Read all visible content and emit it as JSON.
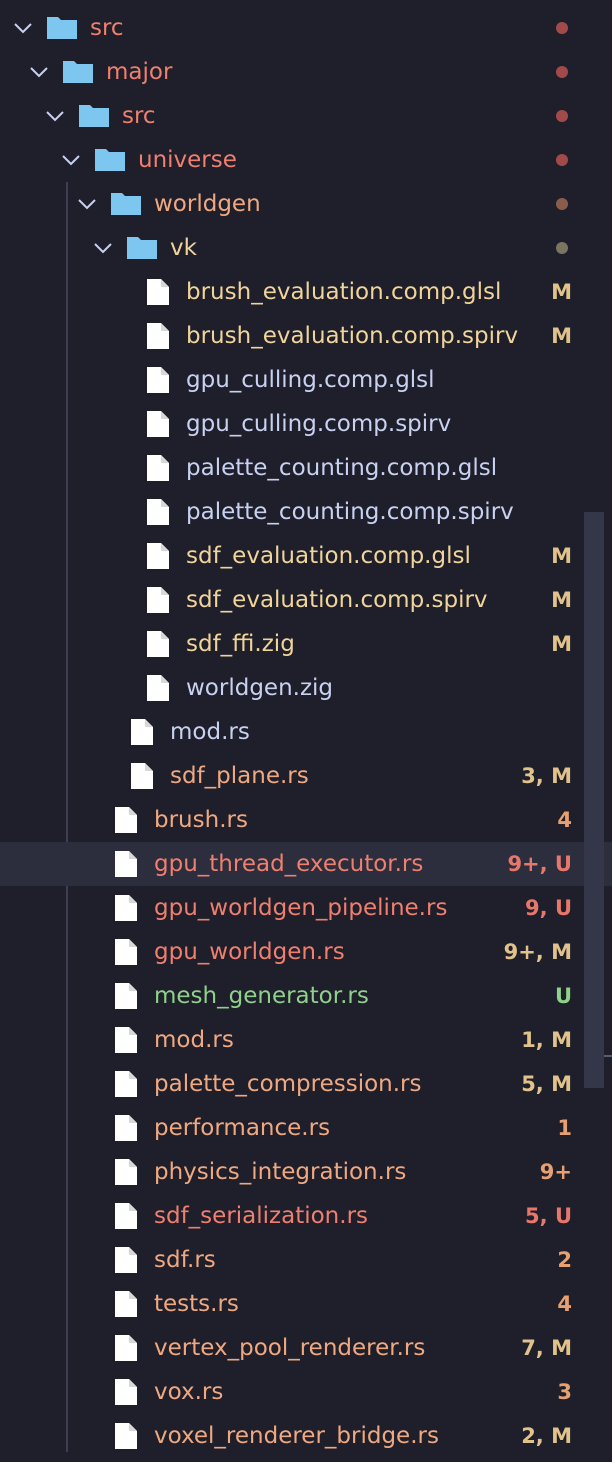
{
  "colors": {
    "background": "#1e1f2b",
    "folder_label": "#f07f6e",
    "file_default": "#c9d1f0",
    "file_modified": "#f0d49a",
    "file_untracked": "#f07f6e",
    "file_added": "#8fd18a",
    "file_warning": "#f0a880",
    "badge_m": "#e0c28a",
    "badge_u_red": "#e8776b",
    "badge_u_green": "#8fd18a",
    "badge_warn": "#e8a070",
    "folder_icon": "#7cc6f0",
    "chevron": "#c9d1f0"
  },
  "explorer": {
    "folders": [
      {
        "name": "src"
      },
      {
        "name": "major"
      },
      {
        "name": "src"
      },
      {
        "name": "universe"
      },
      {
        "name": "worldgen"
      },
      {
        "name": "vk"
      }
    ],
    "vk_files": [
      {
        "name": "brush_evaluation.comp.glsl",
        "badge": "M"
      },
      {
        "name": "brush_evaluation.comp.spirv",
        "badge": "M"
      },
      {
        "name": "gpu_culling.comp.glsl",
        "badge": ""
      },
      {
        "name": "gpu_culling.comp.spirv",
        "badge": ""
      },
      {
        "name": "palette_counting.comp.glsl",
        "badge": ""
      },
      {
        "name": "palette_counting.comp.spirv",
        "badge": ""
      },
      {
        "name": "sdf_evaluation.comp.glsl",
        "badge": "M"
      },
      {
        "name": "sdf_evaluation.comp.spirv",
        "badge": "M"
      },
      {
        "name": "sdf_ffi.zig",
        "badge": "M"
      },
      {
        "name": "worldgen.zig",
        "badge": ""
      }
    ],
    "worldgen_files": [
      {
        "name": "mod.rs",
        "badge": ""
      },
      {
        "name": "sdf_plane.rs",
        "badge": "3, M"
      }
    ],
    "universe_files": [
      {
        "name": "brush.rs",
        "badge": "4"
      },
      {
        "name": "gpu_thread_executor.rs",
        "badge": "9+, U"
      },
      {
        "name": "gpu_worldgen_pipeline.rs",
        "badge": "9, U"
      },
      {
        "name": "gpu_worldgen.rs",
        "badge": "9+, M"
      },
      {
        "name": "mesh_generator.rs",
        "badge": "U"
      },
      {
        "name": "mod.rs",
        "badge": "1, M"
      },
      {
        "name": "palette_compression.rs",
        "badge": "5, M"
      },
      {
        "name": "performance.rs",
        "badge": "1"
      },
      {
        "name": "physics_integration.rs",
        "badge": "9+"
      },
      {
        "name": "sdf_serialization.rs",
        "badge": "5, U"
      },
      {
        "name": "sdf.rs",
        "badge": "2"
      },
      {
        "name": "tests.rs",
        "badge": "4"
      },
      {
        "name": "vertex_pool_renderer.rs",
        "badge": "7, M"
      },
      {
        "name": "vox.rs",
        "badge": "3"
      },
      {
        "name": "voxel_renderer_bridge.rs",
        "badge": "2, M"
      }
    ]
  }
}
